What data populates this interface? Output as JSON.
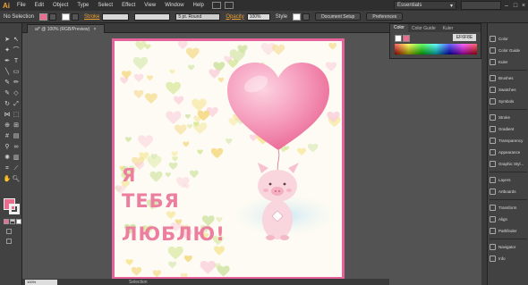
{
  "app": {
    "logo": "Ai"
  },
  "menubar": {
    "items": [
      "File",
      "Edit",
      "Object",
      "Type",
      "Select",
      "Effect",
      "View",
      "Window",
      "Help"
    ],
    "workspace": "Essentials"
  },
  "controlbar": {
    "selection_label": "No Selection",
    "stroke_label": "Stroke",
    "brush_label": "5 pt. Round",
    "opacity_label": "Opacity",
    "opacity_value": "100%",
    "style_label": "Style",
    "document_setup": "Document Setup",
    "preferences": "Preferences"
  },
  "document": {
    "tab_title": "ai* @ 100% (RGB/Preview)",
    "tab_close": "×"
  },
  "color_panel": {
    "tabs": [
      "Color",
      "Color Guide",
      "Kuler"
    ],
    "hex_value": "EF6F8E",
    "fill_color": "#ea6d8f"
  },
  "panels": [
    {
      "label": "Color",
      "icon": "color-icon"
    },
    {
      "label": "Color Guide",
      "icon": "color-guide-icon"
    },
    {
      "label": "Kuler",
      "icon": "kuler-icon"
    },
    {
      "label": "Brushes",
      "icon": "brushes-icon"
    },
    {
      "label": "Swatches",
      "icon": "swatches-icon"
    },
    {
      "label": "Symbols",
      "icon": "symbols-icon"
    },
    {
      "label": "Stroke",
      "icon": "stroke-icon"
    },
    {
      "label": "Gradient",
      "icon": "gradient-icon"
    },
    {
      "label": "Transparency",
      "icon": "transparency-icon"
    },
    {
      "label": "Appearance",
      "icon": "appearance-icon"
    },
    {
      "label": "Graphic Styl...",
      "icon": "graphic-styles-icon"
    },
    {
      "label": "Layers",
      "icon": "layers-icon"
    },
    {
      "label": "Artboards",
      "icon": "artboards-icon"
    },
    {
      "label": "Transform",
      "icon": "transform-icon"
    },
    {
      "label": "Align",
      "icon": "align-icon"
    },
    {
      "label": "Pathfinder",
      "icon": "pathfinder-icon"
    },
    {
      "label": "Navigator",
      "icon": "navigator-icon"
    },
    {
      "label": "Info",
      "icon": "info-icon"
    }
  ],
  "artwork": {
    "line1": "Я",
    "line2": "ТЕБЯ",
    "line3": "ЛЮБЛЮ!",
    "text_color": "#ec7fa0",
    "border_color": "#e5639a",
    "balloon_color": "#f07ba3"
  },
  "statusbar": {
    "zoom": "100%",
    "tool": "Selection"
  }
}
